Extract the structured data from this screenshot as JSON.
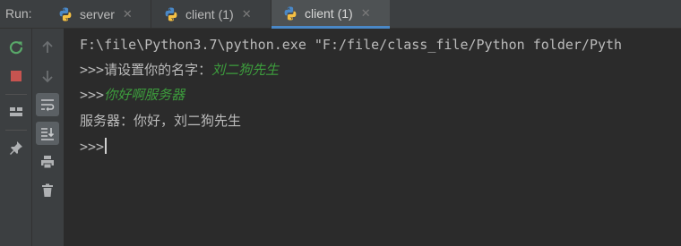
{
  "toolwindow": {
    "label": "Run:",
    "tabs": [
      {
        "label": "server",
        "active": false
      },
      {
        "label": "client (1)",
        "active": false
      },
      {
        "label": "client (1)",
        "active": true
      }
    ],
    "close_glyph": "✕"
  },
  "toolbar": {
    "left": [
      "rerun-icon",
      "stop-icon",
      "layout-icon",
      "pin-icon"
    ],
    "right": [
      "up-arrow-icon",
      "down-arrow-icon",
      "soft-wrap-icon",
      "scroll-to-end-icon",
      "print-icon",
      "trash-icon"
    ]
  },
  "console": {
    "command_line": "F:\\file\\Python3.7\\python.exe \"F:/file/class_file/Python folder/Pyth",
    "prompt1_text": ">>>请设置你的名字：",
    "prompt1_input": "刘二狗先生",
    "prompt2_text": ">>>",
    "prompt2_input": "你好啊服务器",
    "server_reply": "服务器：你好，刘二狗先生",
    "prompt3_text": ">>>"
  },
  "colors": {
    "background": "#2b2b2b",
    "panel": "#3c3f41",
    "text": "#bbbbbb",
    "user_input": "#3d9e3d",
    "active_tab_underline": "#4a88c7",
    "rerun_green": "#59a869",
    "stop_red": "#c75450"
  }
}
